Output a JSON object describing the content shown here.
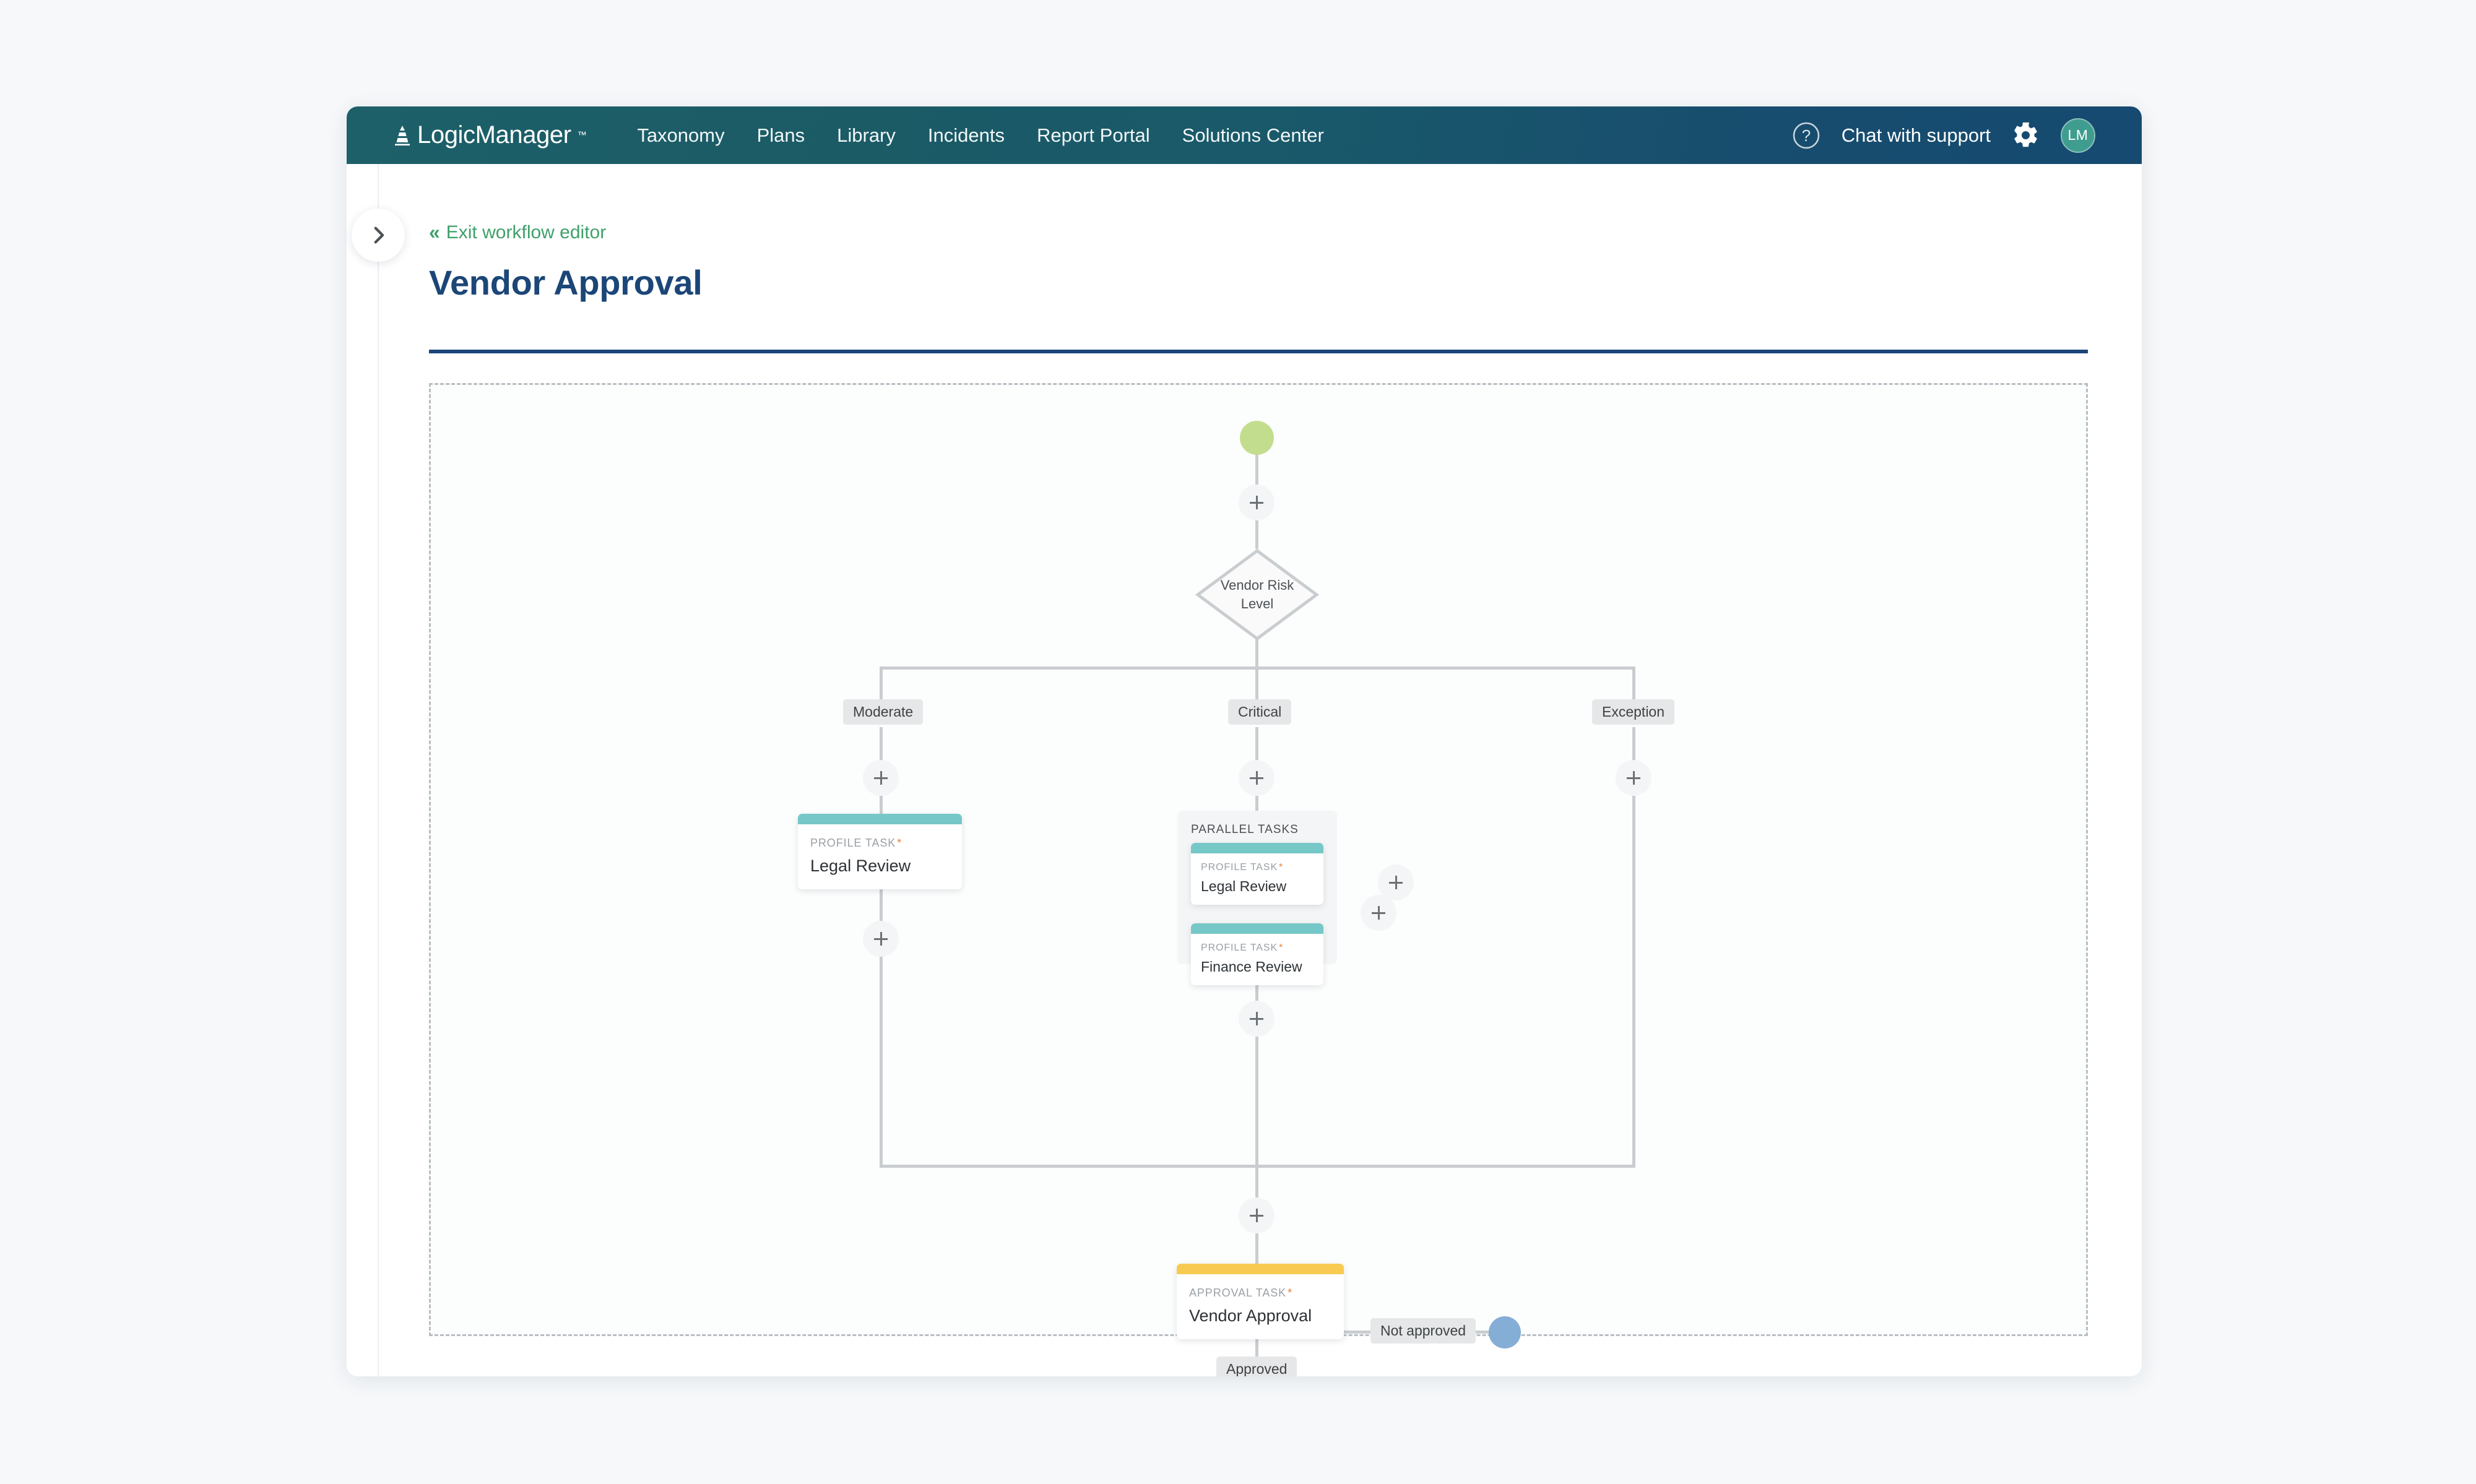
{
  "navbar": {
    "brand": "LogicManager",
    "brand_tm": "™",
    "items": [
      {
        "label": "Taxonomy"
      },
      {
        "label": "Plans"
      },
      {
        "label": "Library"
      },
      {
        "label": "Incidents"
      },
      {
        "label": "Report Portal"
      },
      {
        "label": "Solutions Center"
      }
    ],
    "help_icon": "question-circle-icon",
    "chat_label": "Chat with support",
    "gear_icon": "gear-icon",
    "avatar_initials": "LM"
  },
  "page": {
    "exit_chevrons": "«",
    "exit_label": "Exit workflow editor",
    "title": "Vendor Approval",
    "sidebar_toggle_icon": "chevron-right-icon"
  },
  "workflow": {
    "start_node": "start-node",
    "decision": {
      "line1": "Vendor Risk",
      "line2": "Level"
    },
    "branches": [
      {
        "label": "Moderate"
      },
      {
        "label": "Critical"
      },
      {
        "label": "Exception"
      }
    ],
    "moderate_task": {
      "kind": "PROFILE TASK",
      "required": "*",
      "title": "Legal Review",
      "bar_color": "#76c8c8"
    },
    "parallel_group": {
      "label": "PARALLEL TASKS",
      "tasks": [
        {
          "kind": "PROFILE TASK",
          "required": "*",
          "title": "Legal Review",
          "bar_color": "#76c8c8"
        },
        {
          "kind": "PROFILE TASK",
          "required": "*",
          "title": "Finance Review",
          "bar_color": "#76c8c8"
        }
      ]
    },
    "approval_task": {
      "kind": "APPROVAL TASK",
      "required": "*",
      "title": "Vendor Approval",
      "bar_color": "#f8ca51"
    },
    "outcomes": {
      "not_approved": "Not approved",
      "approved": "Approved"
    },
    "end_node": "end-node-blue",
    "add_button_label": "+"
  },
  "colors": {
    "nav_teal": "#1d6069",
    "nav_blue": "#164a70",
    "title_blue": "#1b4677",
    "exit_green": "#3fa06a",
    "start_green": "#c3dd8e",
    "end_blue": "#85aed6",
    "task_teal": "#76c8c8",
    "approval_yellow": "#f8ca51",
    "required_orange": "#e8803a"
  }
}
